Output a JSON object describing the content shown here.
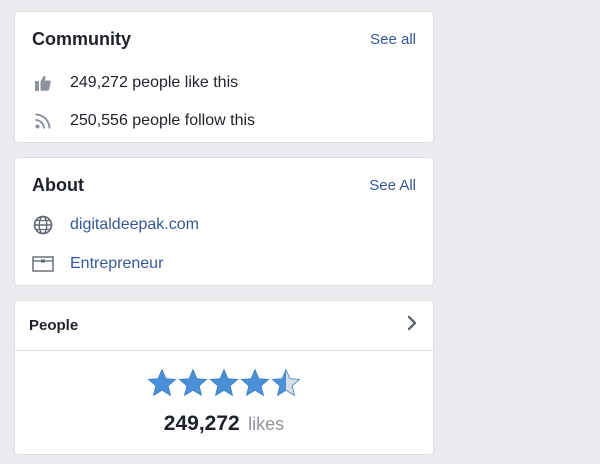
{
  "community": {
    "title": "Community",
    "see_all": "See all",
    "likes_text": "249,272 people like this",
    "follows_text": "250,556 people follow this",
    "likes_icon": "thumbs-up-icon",
    "follows_icon": "rss-icon"
  },
  "about": {
    "title": "About",
    "see_all": "See All",
    "website": "digitaldeepak.com",
    "category": "Entrepreneur",
    "website_icon": "globe-icon",
    "category_icon": "briefcase-icon"
  },
  "people": {
    "title": "People",
    "rating": 4.5,
    "rating_max": 5,
    "likes_count": "249,272",
    "likes_unit": "likes"
  },
  "colors": {
    "background": "#e9ebee",
    "link": "#365899",
    "text": "#1d2129",
    "muted": "#90949c",
    "star": "#4a90d9",
    "star_empty": "#dadde1"
  }
}
